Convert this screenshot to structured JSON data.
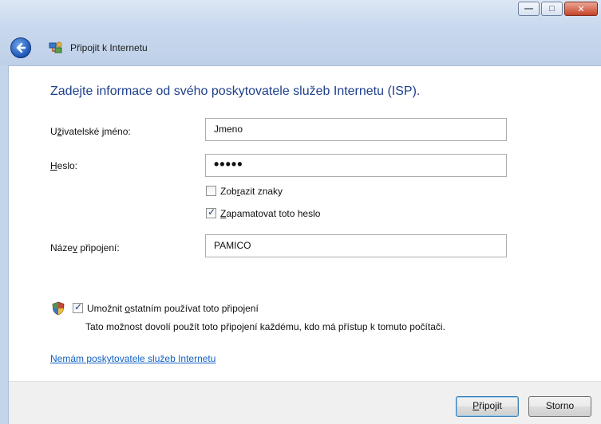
{
  "window": {
    "title": "Připojit k Internetu",
    "controls": {
      "minimize": "—",
      "maximize": "□",
      "close": "✕"
    }
  },
  "heading": "Zadejte informace od svého poskytovatele služeb Internetu (ISP).",
  "form": {
    "username": {
      "label_pre": "U",
      "label_key": "ž",
      "label_post": "ivatelské jméno:",
      "value": "Jmeno"
    },
    "password": {
      "label_key": "H",
      "label_post": "eslo:",
      "masked_value": "•••••"
    },
    "show_chars": {
      "label_pre": "Zob",
      "label_key": "r",
      "label_post": "azit znaky",
      "checked": false
    },
    "remember": {
      "label_key": "Z",
      "label_post": "apamatovat toto heslo",
      "checked": true
    },
    "connection_name": {
      "label_pre": "Náze",
      "label_key": "v",
      "label_post": " připojení:",
      "value": "PAMICO"
    }
  },
  "share": {
    "label_pre": "Umožnit ",
    "label_key": "o",
    "label_post": "statním používat toto připojení",
    "checked": true,
    "note": "Tato možnost dovolí použít toto připojení každému, kdo má přístup k tomuto počítači."
  },
  "link": "Nemám poskytovatele služeb Internetu",
  "buttons": {
    "connect": {
      "label_key": "P",
      "label_post": "řipojit"
    },
    "cancel": "Storno"
  },
  "colors": {
    "heading": "#1e3f8c",
    "link": "#1160c4",
    "glass": "#c9d9ee"
  }
}
